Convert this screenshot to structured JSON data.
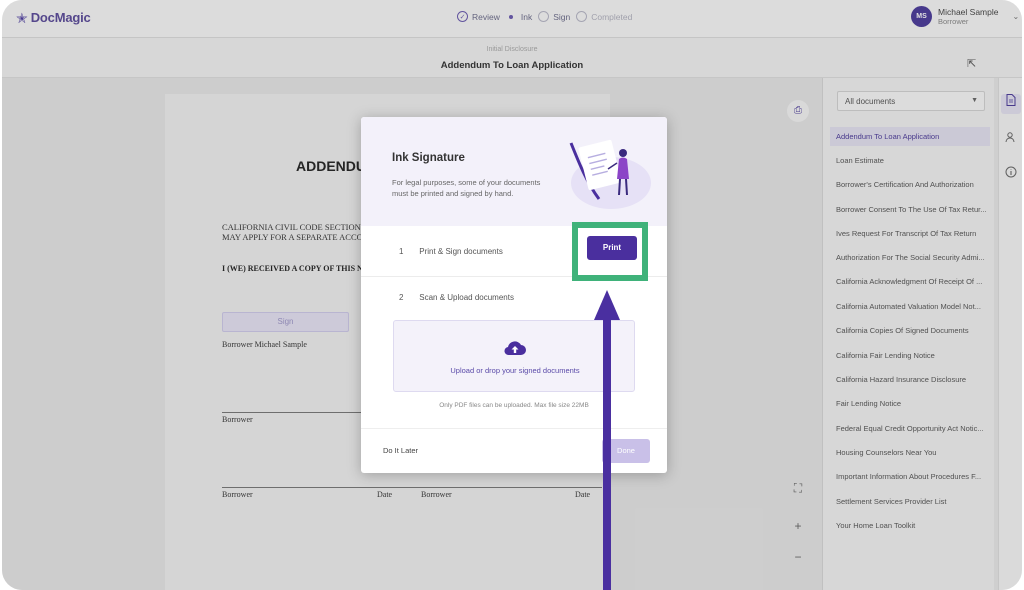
{
  "app": {
    "logo_text": "DocMagic",
    "steps": [
      {
        "label": "Review",
        "state": "done"
      },
      {
        "label": "Ink",
        "state": "current"
      },
      {
        "label": "Sign",
        "state": "pending"
      },
      {
        "label": "Completed",
        "state": "pending"
      }
    ],
    "user": {
      "initials": "MS",
      "name": "Michael Sample",
      "role": "Borrower"
    }
  },
  "subheader": {
    "category": "Initial Disclosure",
    "title": "Addendum To Loan Application"
  },
  "document": {
    "heading": "ADDENDU",
    "para_line1": "CALIFORNIA CIVIL CODE SECTION 1",
    "para_line2": "MAY APPLY FOR A SEPARATE ACCO",
    "received": "I (WE) RECEIVED A COPY OF THIS N",
    "sign_label": "Sign",
    "borrower_name_label": "Borrower Michael Sample",
    "borrower_label_1": "Borrower",
    "borrower_label_2": "Borrower",
    "date_label_1": "Date",
    "borrower_label_3": "Borrower",
    "date_label_2": "Date"
  },
  "doc_filter": {
    "selected": "All documents"
  },
  "documents": [
    "Addendum To Loan Application",
    "Loan Estimate",
    "Borrower's Certification And Authorization",
    "Borrower Consent To The Use Of Tax Retur...",
    "Ives Request For Transcript Of Tax Return",
    "Authorization For The Social Security Admi...",
    "California Acknowledgment Of Receipt Of ...",
    "California Automated Valuation Model Not...",
    "California Copies Of Signed Documents",
    "California Fair Lending Notice",
    "California Hazard Insurance Disclosure",
    "Fair Lending Notice",
    "Federal Equal Credit Opportunity Act Notic...",
    "Housing Counselors Near You",
    "Important Information About Procedures F...",
    "Settlement Services Provider List",
    "Your Home Loan Toolkit"
  ],
  "modal": {
    "title": "Ink Signature",
    "description": "For legal purposes, some of your documents must be printed and signed by hand.",
    "step1_num": "1",
    "step1_label": "Print & Sign documents",
    "print_label": "Print",
    "step2_num": "2",
    "step2_label": "Scan & Upload documents",
    "upload_text": "Upload or drop your signed documents",
    "upload_note": "Only PDF files can be uploaded. Max file size 22MB",
    "later_label": "Do It Later",
    "done_label": "Done"
  },
  "icons": {
    "logo": "star-icon",
    "print_top": "printer-icon",
    "upload": "cloud-upload-icon",
    "rail": [
      "document-icon",
      "users-icon",
      "info-icon"
    ]
  },
  "colors": {
    "brand": "#4a2f9e",
    "highlight": "#3fb27a",
    "arrow": "#4a2fa0"
  }
}
